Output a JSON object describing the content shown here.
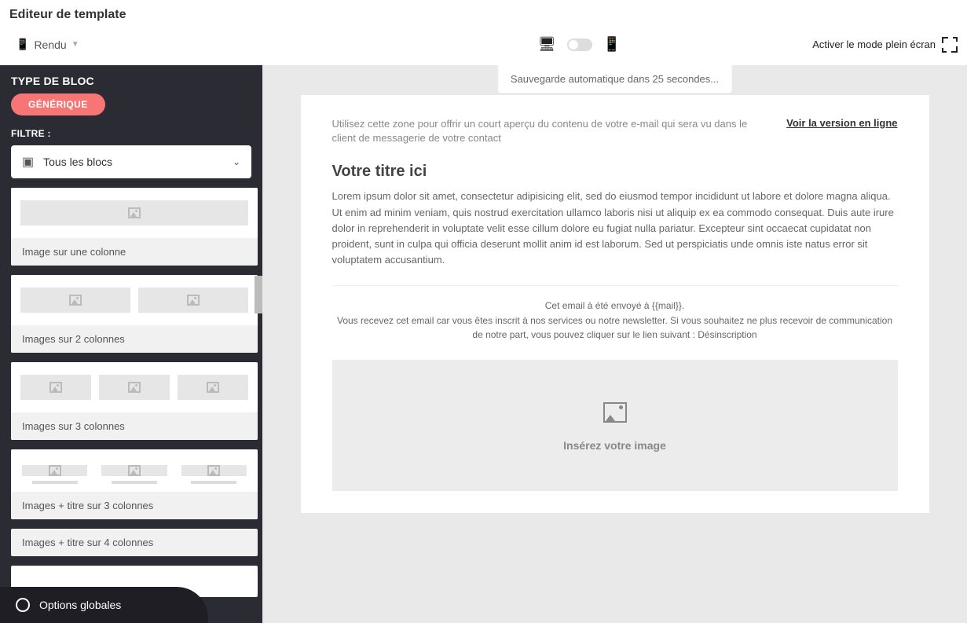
{
  "page_title": "Editeur de template",
  "toolbar": {
    "rendu_label": "Rendu",
    "fullscreen_label": "Activer le mode plein écran"
  },
  "autosave_text": "Sauvegarde automatique dans 25 secondes...",
  "sidebar": {
    "section_title": "TYPE DE BLOC",
    "tab_label": "GÉNÉRIQUE",
    "filter_label": "FILTRE :",
    "filter_value": "Tous les blocs",
    "blocks": [
      {
        "label": "Image sur une colonne"
      },
      {
        "label": "Images sur 2 colonnes"
      },
      {
        "label": "Images sur 3 colonnes"
      },
      {
        "label": "Images + titre sur 3 colonnes"
      },
      {
        "label": "Images + titre sur 4 colonnes"
      }
    ],
    "options_label": "Options globales"
  },
  "email": {
    "preview_text": "Utilisez cette zone pour offrir un court aperçu du contenu de votre e-mail qui sera vu dans le client de messagerie de votre contact",
    "online_link": "Voir la version en ligne",
    "title": "Votre titre ici",
    "body": "Lorem ipsum dolor sit amet, consectetur adipisicing elit, sed do eiusmod tempor incididunt ut labore et dolore magna aliqua. Ut enim ad minim veniam, quis nostrud exercitation ullamco laboris nisi ut aliquip ex ea commodo consequat. Duis aute irure dolor in reprehenderit in voluptate velit esse cillum dolore eu fugiat nulla pariatur. Excepteur sint occaecat cupidatat non proident, sunt in culpa qui officia deserunt mollit anim id est laborum. Sed ut perspiciatis unde omnis iste natus error sit voluptatem accusantium.",
    "footer_line1": "Cet email à été envoyé à {{mail}}.",
    "footer_line2": "Vous recevez cet email car vous êtes inscrit à nos services ou notre newsletter. Si vous souhaitez ne plus recevoir de communication de notre part, vous pouvez cliquer sur le lien suivant : Désinscription",
    "image_drop_label": "Insérez votre image"
  }
}
